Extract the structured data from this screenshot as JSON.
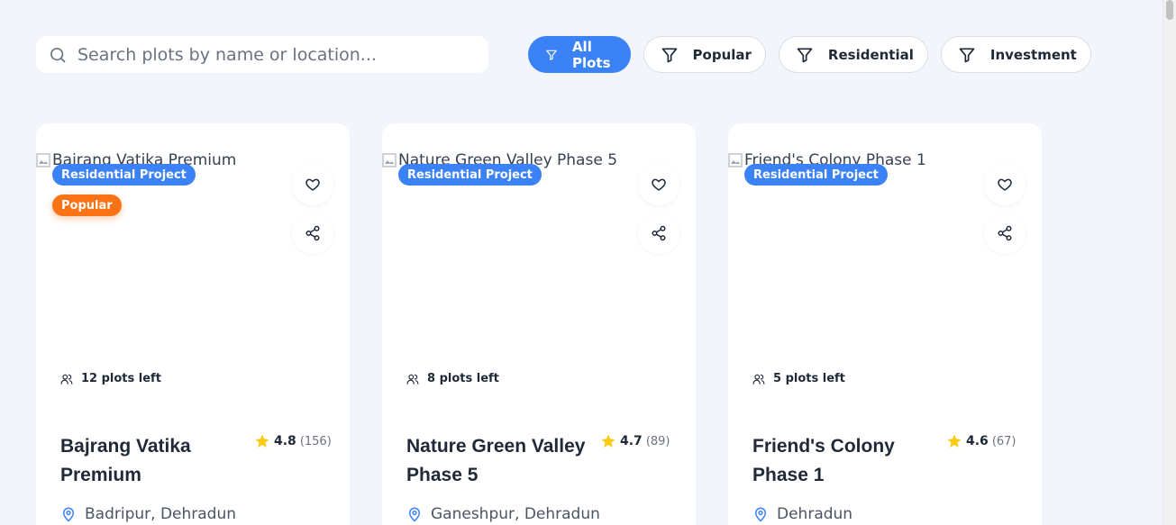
{
  "search": {
    "placeholder": "Search plots by name or location..."
  },
  "filters": [
    {
      "label": "All Plots",
      "active": true
    },
    {
      "label": "Popular",
      "active": false
    },
    {
      "label": "Residential",
      "active": false
    },
    {
      "label": "Investment",
      "active": false
    }
  ],
  "cards": [
    {
      "image_alt": "Bajrang Vatika Premium",
      "badge": "Residential Project",
      "popular_badge": "Popular",
      "plots_left": "12 plots left",
      "title": "Bajrang Vatika Premium",
      "rating": "4.8",
      "reviews": "(156)",
      "location": "Badripur, Dehradun"
    },
    {
      "image_alt": "Nature Green Valley Phase 5",
      "badge": "Residential Project",
      "plots_left": "8 plots left",
      "title": "Nature Green Valley Phase 5",
      "rating": "4.7",
      "reviews": "(89)",
      "location": "Ganeshpur, Dehradun"
    },
    {
      "image_alt": "Friend's Colony Phase 1",
      "badge": "Residential Project",
      "plots_left": "5 plots left",
      "title": "Friend's Colony Phase 1",
      "rating": "4.6",
      "reviews": "(67)",
      "location": "Dehradun"
    }
  ],
  "icons": {
    "search": "search-icon",
    "filter": "filter-icon",
    "heart": "heart-icon",
    "share": "share-icon",
    "users": "users-icon",
    "star": "star-icon",
    "location": "map-pin-icon"
  },
  "colors": {
    "accent": "#3b82f6",
    "popular": "#f97316",
    "star": "#facc15",
    "background": "#f2f6fc"
  }
}
